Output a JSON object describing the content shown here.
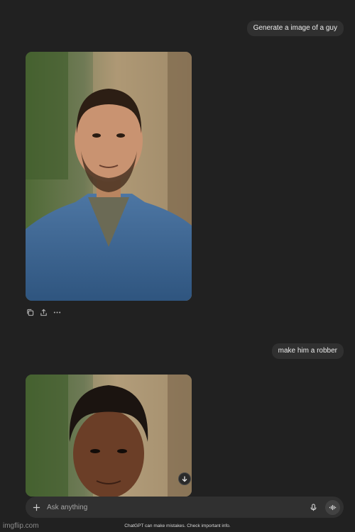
{
  "conversation": {
    "messages": [
      {
        "role": "user",
        "text": "Generate a image of a guy"
      },
      {
        "role": "assistant",
        "type": "image"
      },
      {
        "role": "user",
        "text": "make him a robber"
      },
      {
        "role": "assistant",
        "type": "image"
      }
    ],
    "actions": [
      "copy-icon",
      "share-icon",
      "more-icon"
    ]
  },
  "composer": {
    "placeholder": "Ask anything",
    "plus_icon": "plus-icon",
    "mic_icon": "mic-icon",
    "voice_icon": "voice-mode-icon"
  },
  "footer": {
    "disclaimer": "ChatGPT can make mistakes. Check important info.",
    "watermark": "imgflip.com"
  },
  "colors": {
    "background": "#212121",
    "bubble": "#303030",
    "text": "#ececec"
  }
}
